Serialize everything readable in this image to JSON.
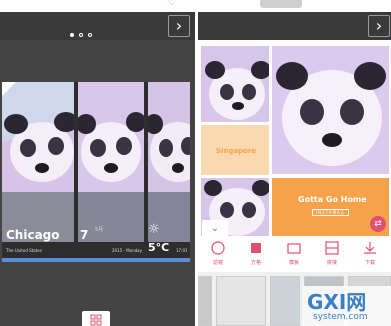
{
  "left_screen": {
    "caption": {
      "city": "Chicago",
      "day": "7",
      "month": "5月",
      "country": "The United States",
      "date": "2015 - Monday",
      "temperature": "5°C",
      "time": "17:01"
    },
    "pagination": {
      "total": 3,
      "active": 0
    }
  },
  "right_screen": {
    "tiles": {
      "singapore": "Singapore",
      "gotta_go_home": "Gotta Go Home",
      "subtag": "INSTAMAG"
    },
    "toolbar": [
      {
        "label": "滤镜",
        "icon": "filter-icon"
      },
      {
        "label": "方格",
        "icon": "square-icon"
      },
      {
        "label": "模板",
        "icon": "frame-icon"
      },
      {
        "label": "拼接",
        "icon": "grid-icon"
      },
      {
        "label": "下载",
        "icon": "download-icon"
      }
    ]
  },
  "watermark": {
    "brand": "GXI网",
    "url": "system.com"
  },
  "colors": {
    "accent": "#e05070",
    "orange": "#f5a24a",
    "caption_bar": "#5a8fd6"
  }
}
